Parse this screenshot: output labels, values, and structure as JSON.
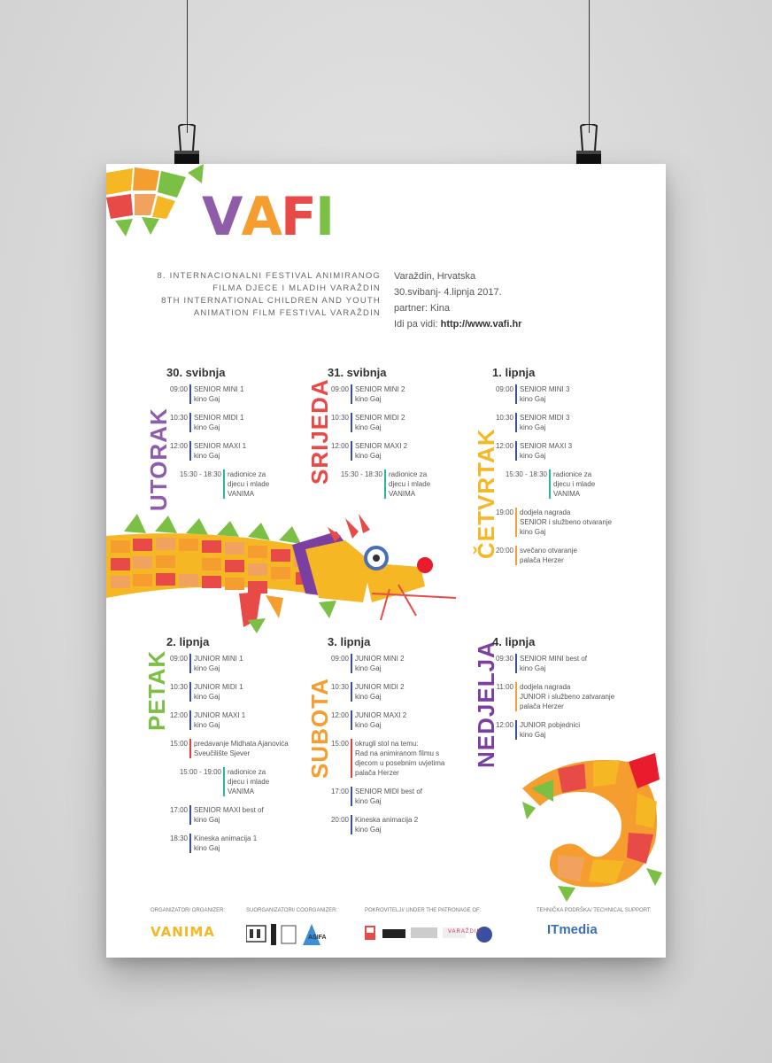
{
  "logo": {
    "letters": [
      "V",
      "A",
      "F",
      "I"
    ],
    "colors": [
      "#8e5ca8",
      "#f59e2f",
      "#e84a47",
      "#7bbf45"
    ]
  },
  "subtitle_hr": [
    "8. Internacionalni festival animiranog",
    "filma djece i mladih Varaždin"
  ],
  "subtitle_en": [
    "8th International children and youth",
    "animation film festival Varaždin"
  ],
  "info": {
    "city": "Varaždin, Hrvatska",
    "dates": "30.svibanj- 4.lipnja 2017.",
    "partner": "partner: Kina",
    "link_prefix": "Idi pa vidi: ",
    "link": "http://www.vafi.hr"
  },
  "days": [
    {
      "weekday": "UTORAK",
      "color": "#8e5ca8",
      "date": "30. svibnja",
      "events": [
        {
          "time": "09:00",
          "line1": "SENIOR MINI 1",
          "line2": "kino Gaj",
          "bar": "blue"
        },
        {
          "time": "10:30",
          "line1": "SENIOR MIDI 1",
          "line2": "kino Gaj",
          "bar": "blue"
        },
        {
          "time": "12:00",
          "line1": "SENIOR MAXI 1",
          "line2": "kino Gaj",
          "bar": "blue"
        },
        {
          "time": "15:30 - 18:30",
          "line1": "radionice za",
          "line2": "djecu i mlade",
          "line3": "VANIMA",
          "bar": "teal"
        }
      ]
    },
    {
      "weekday": "SRIJEDA",
      "color": "#e84a47",
      "date": "31. svibnja",
      "events": [
        {
          "time": "09:00",
          "line1": "SENIOR MINI 2",
          "line2": "kino Gaj",
          "bar": "blue"
        },
        {
          "time": "10:30",
          "line1": "SENIOR MIDI 2",
          "line2": "kino Gaj",
          "bar": "blue"
        },
        {
          "time": "12:00",
          "line1": "SENIOR MAXI 2",
          "line2": "kino Gaj",
          "bar": "blue"
        },
        {
          "time": "15:30 - 18:30",
          "line1": "radionice za",
          "line2": "djecu i mlade",
          "line3": "VANIMA",
          "bar": "teal"
        }
      ]
    },
    {
      "weekday": "ČETVRTAK",
      "color": "#f5b824",
      "date": "1. lipnja",
      "events": [
        {
          "time": "09:00",
          "line1": "SENIOR MINI 3",
          "line2": "kino Gaj",
          "bar": "blue"
        },
        {
          "time": "10:30",
          "line1": "SENIOR MIDI 3",
          "line2": "kino Gaj",
          "bar": "blue"
        },
        {
          "time": "12:00",
          "line1": "SENIOR MAXI 3",
          "line2": "kino Gaj",
          "bar": "blue"
        },
        {
          "time": "15:30 - 18:30",
          "line1": "radionice za",
          "line2": "djecu i mlade",
          "line3": "VANIMA",
          "bar": "teal"
        },
        {
          "time": "19:00",
          "line1": "dodjela nagrada",
          "line2": "SENIOR i službeno otvaranje",
          "line3": "kino Gaj",
          "bar": "orange"
        },
        {
          "time": "20:00",
          "line1": "svečano otvaranje",
          "line2": "palača Herzer",
          "bar": "orange"
        }
      ]
    },
    {
      "weekday": "PETAK",
      "color": "#7bbf45",
      "date": "2. lipnja",
      "events": [
        {
          "time": "09:00",
          "line1": "JUNIOR MINI 1",
          "line2": "kino Gaj",
          "bar": "blue"
        },
        {
          "time": "10:30",
          "line1": "JUNIOR MIDI 1",
          "line2": "kino Gaj",
          "bar": "blue"
        },
        {
          "time": "12:00",
          "line1": "JUNIOR MAXI 1",
          "line2": "kino Gaj",
          "bar": "blue"
        },
        {
          "time": "15:00",
          "line1": "predavanje Midhata Ajanovića",
          "line2": "Sveučilište Sjever",
          "bar": "red"
        },
        {
          "time": "15:00 - 19:00",
          "line1": "radionice za",
          "line2": "djecu i mlade",
          "line3": "VANIMA",
          "bar": "teal"
        },
        {
          "time": "17:00",
          "line1": "SENIOR MAXI best of",
          "line2": "kino Gaj",
          "bar": "blue"
        },
        {
          "time": "18:30",
          "line1": "Kineska animacija 1",
          "line2": "kino Gaj",
          "bar": "blue"
        }
      ]
    },
    {
      "weekday": "SUBOTA",
      "color": "#f59e2f",
      "date": "3. lipnja",
      "events": [
        {
          "time": "09:00",
          "line1": "JUNIOR MINI 2",
          "line2": "kino Gaj",
          "bar": "blue"
        },
        {
          "time": "10:30",
          "line1": "JUNIOR MIDI 2",
          "line2": "kino Gaj",
          "bar": "blue"
        },
        {
          "time": "12:00",
          "line1": "JUNIOR MAXI 2",
          "line2": "kino Gaj",
          "bar": "blue"
        },
        {
          "time": "15:00",
          "line1": "okrugli stol na temu:",
          "line2": "Rad na animiranom filmu s",
          "line3": "djecom u posebnim uvjetima",
          "line4": "palača Herzer",
          "bar": "red"
        },
        {
          "time": "17:00",
          "line1": "SENIOR MIDI best of",
          "line2": "kino Gaj",
          "bar": "blue"
        },
        {
          "time": "20:00",
          "line1": "Kineska animacija 2",
          "line2": "kino Gaj",
          "bar": "blue"
        }
      ]
    },
    {
      "weekday": "NEDJELJA",
      "color": "#7a3fa0",
      "date": "4. lipnja",
      "events": [
        {
          "time": "09:30",
          "line1": "SENIOR MINI best of",
          "line2": "kino Gaj",
          "bar": "blue"
        },
        {
          "time": "11:00",
          "line1": "dodjela nagrada",
          "line2": "JUNIOR i službeno zatvaranje",
          "line3": "palača Herzer",
          "bar": "orange"
        },
        {
          "time": "12:00",
          "line1": "JUNIOR pobjednici",
          "line2": "kino Gaj",
          "bar": "blue"
        }
      ]
    }
  ],
  "sponsors": {
    "organizer": "ORGANIZATOR/ ORGANIZER:",
    "coorganizer": "SUORGANIZATORI/ COORGANIZER:",
    "patronage": "POKROVITELJI/ UNDER THE PATRONAGE OF:",
    "support": "TEHNIČKA PODRŠKA/ TECHNICAL SUPPORT:",
    "vanima": "VANIMA",
    "asifa": "ASIFA",
    "varazdin": "VARAŽDIN",
    "itmedia": "ITmedia"
  }
}
